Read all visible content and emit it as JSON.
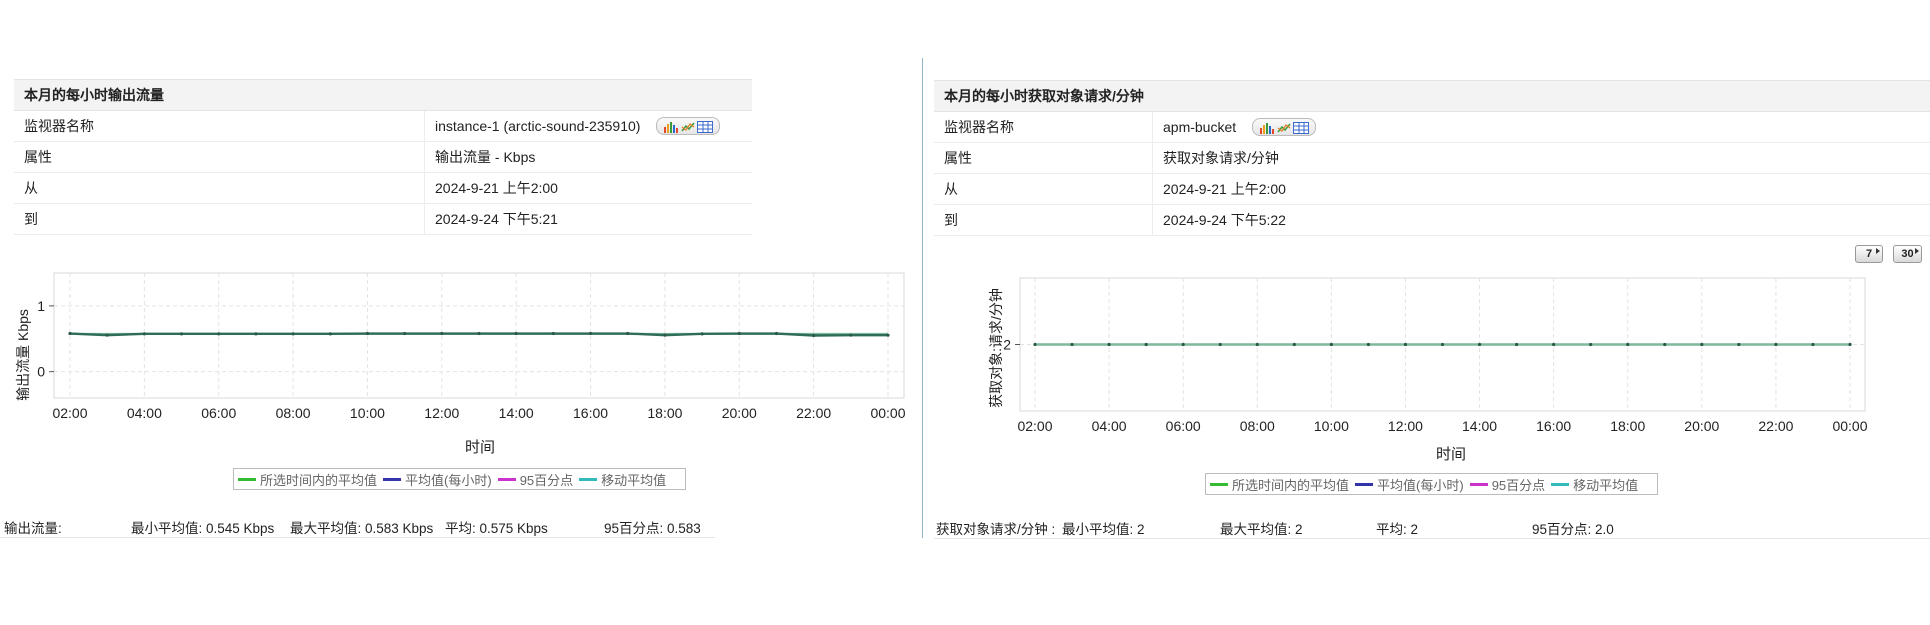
{
  "colors": {
    "series_overall_avg": "#33bb33",
    "series_hourly_avg": "#3333aa",
    "series_p95": "#cc33cc",
    "series_moving_avg": "#33bbbb",
    "line_main": "#2f6d5a",
    "divider": "#8fb5c4"
  },
  "left": {
    "title": "本月的每小时输出流量",
    "rows": [
      {
        "key": "监视器名称",
        "value": "instance-1 (arctic-sound-235910)",
        "tools": true
      },
      {
        "key": "属性",
        "value": "输出流量 - Kbps"
      },
      {
        "key": "从",
        "value": "2024-9-21 上午2:00"
      },
      {
        "key": "到",
        "value": "2024-9-24 下午5:21"
      }
    ],
    "legend": [
      "所选时间内的平均值",
      "平均值(每小时)",
      "95百分点",
      "移动平均值"
    ],
    "summary": {
      "label": "输出流量:",
      "min": "最小平均值:  0.545  Kbps",
      "max": "最大平均值:  0.583  Kbps",
      "avg": "平均:  0.575  Kbps",
      "p95": "95百分点:  0.583"
    },
    "chart_data": {
      "type": "line",
      "xlabel": "时间",
      "ylabel": "输出流量 Kbps",
      "x_ticks": [
        "02:00",
        "04:00",
        "06:00",
        "08:00",
        "10:00",
        "12:00",
        "14:00",
        "16:00",
        "18:00",
        "20:00",
        "22:00",
        "00:00"
      ],
      "y_ticks": [
        "0",
        "1"
      ],
      "ylim": [
        -0.4,
        1.5
      ],
      "grid": true,
      "series": [
        {
          "name": "所选时间内的平均值",
          "values": [
            0.575,
            0.575,
            0.575,
            0.575,
            0.575,
            0.575,
            0.575,
            0.575,
            0.575,
            0.575,
            0.575,
            0.575,
            0.575,
            0.575,
            0.575,
            0.575,
            0.575,
            0.575,
            0.575,
            0.575,
            0.575,
            0.575,
            0.575
          ]
        },
        {
          "name": "平均值(每小时)",
          "values": [
            0.58,
            0.555,
            0.575,
            0.575,
            0.575,
            0.575,
            0.575,
            0.575,
            0.58,
            0.58,
            0.58,
            0.58,
            0.58,
            0.58,
            0.58,
            0.58,
            0.555,
            0.575,
            0.58,
            0.58,
            0.55,
            0.555,
            0.555
          ]
        }
      ]
    }
  },
  "right": {
    "title": "本月的每小时获取对象请求/分钟",
    "rows": [
      {
        "key": "监视器名称",
        "value": "apm-bucket",
        "tools": true
      },
      {
        "key": "属性",
        "value": "获取对象请求/分钟"
      },
      {
        "key": "从",
        "value": "2024-9-21 上午2:00"
      },
      {
        "key": "到",
        "value": "2024-9-24 下午5:22"
      }
    ],
    "buttons": [
      "7",
      "30"
    ],
    "legend": [
      "所选时间内的平均值",
      "平均值(每小时)",
      "95百分点",
      "移动平均值"
    ],
    "summary": {
      "label": "获取对象请求/分钟 :",
      "min": "最小平均值:  2",
      "max": "最大平均值:  2",
      "avg": "平均:  2",
      "p95": "95百分点:  2.0"
    },
    "chart_data": {
      "type": "line",
      "xlabel": "时间",
      "ylabel": "获取对象:请求/分钟",
      "x_ticks": [
        "02:00",
        "04:00",
        "06:00",
        "08:00",
        "10:00",
        "12:00",
        "14:00",
        "16:00",
        "18:00",
        "20:00",
        "22:00",
        "00:00"
      ],
      "y_ticks": [
        "2"
      ],
      "ylim": [
        1,
        3
      ],
      "grid": true,
      "series": [
        {
          "name": "平均值(每小时)",
          "values": [
            2,
            2,
            2,
            2,
            2,
            2,
            2,
            2,
            2,
            2,
            2,
            2,
            2,
            2,
            2,
            2,
            2,
            2,
            2,
            2,
            2,
            2,
            2
          ]
        }
      ]
    }
  }
}
